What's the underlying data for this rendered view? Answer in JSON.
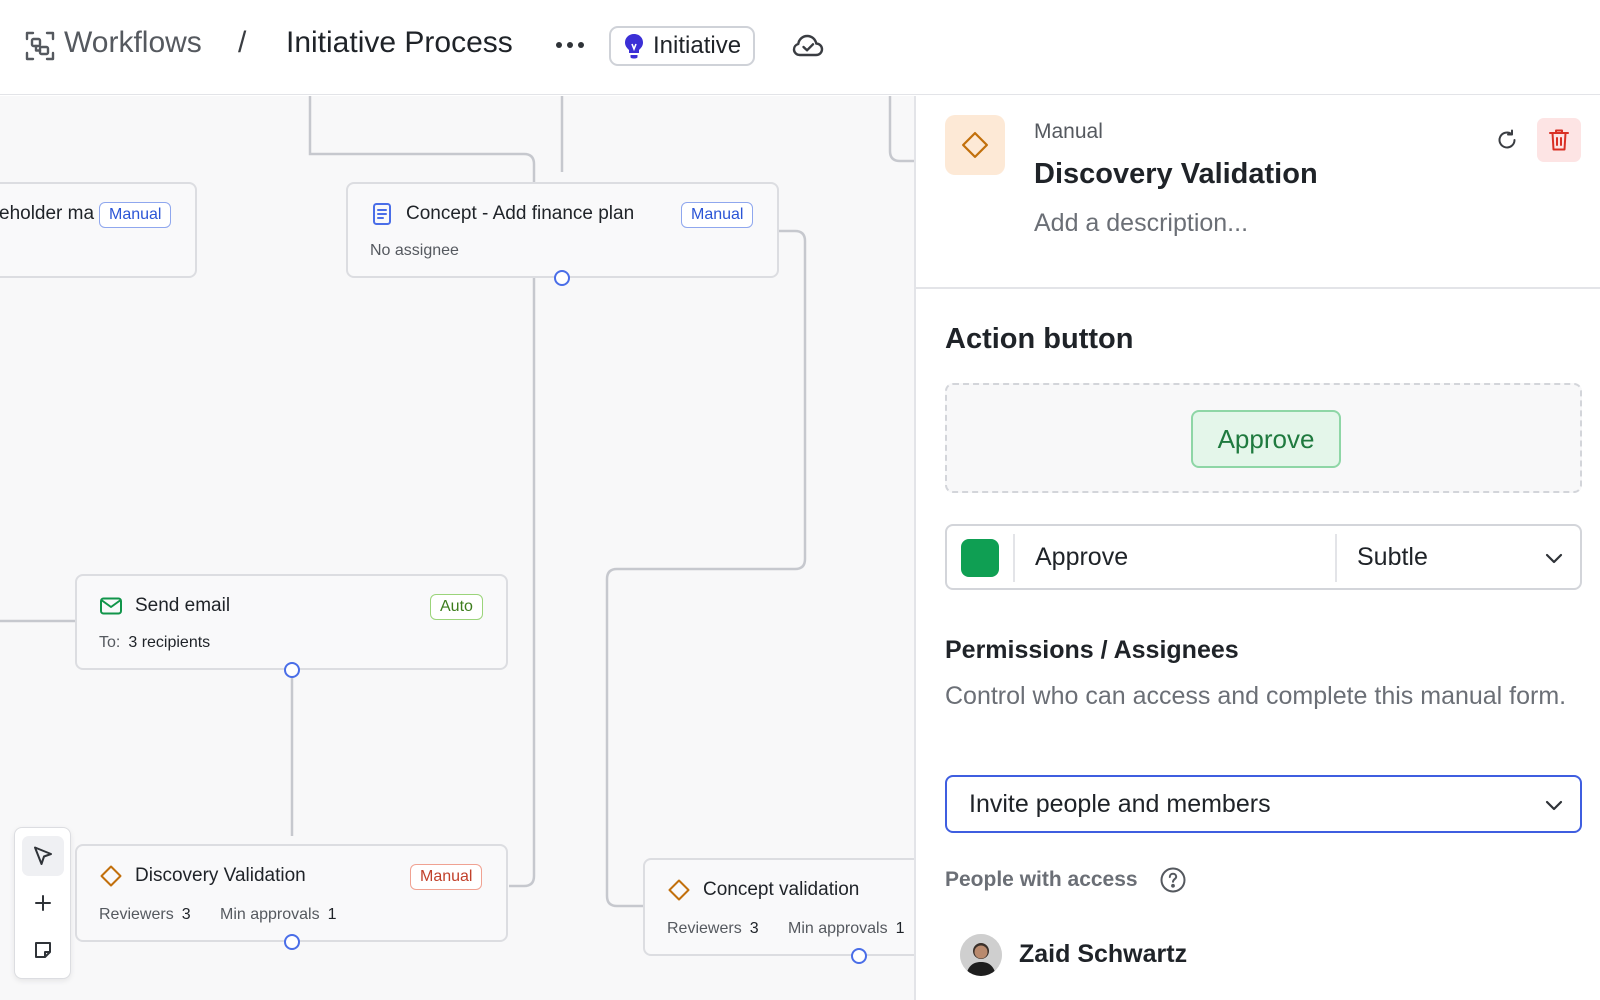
{
  "header": {
    "breadcrumb_root": "Workflows",
    "separator": "/",
    "title": "Initiative Process",
    "type_pill": "Initiative",
    "icons": [
      "workflow-icon",
      "more-icon",
      "lightbulb-icon",
      "cloud-check-icon"
    ]
  },
  "canvas": {
    "nodes": {
      "stakeholder": {
        "title": "eholder ma",
        "tag": "Manual"
      },
      "finance": {
        "title": "Concept - Add finance plan",
        "tag": "Manual",
        "sub": "No assignee"
      },
      "email": {
        "title": "Send email",
        "tag": "Auto",
        "sub_label": "To:",
        "sub_value": "3 recipients"
      },
      "discovery": {
        "title": "Discovery Validation",
        "tag": "Manual",
        "reviewers_label": "Reviewers",
        "reviewers_value": "3",
        "min_label": "Min approvals",
        "min_value": "1"
      },
      "concept": {
        "title": "Concept validation",
        "reviewers_label": "Reviewers",
        "reviewers_value": "3",
        "min_label": "Min approvals",
        "min_value": "1"
      }
    },
    "tools": [
      "pointer-icon",
      "plus-icon",
      "note-icon"
    ]
  },
  "panel": {
    "kind": "Manual",
    "title": "Discovery Validation",
    "description_placeholder": "Add a description...",
    "action_section_title": "Action button",
    "preview_button_label": "Approve",
    "button_label": "Approve",
    "button_style": "Subtle",
    "button_color": "#0f9f53",
    "permissions_title": "Permissions / Assignees",
    "permissions_desc": "Control who can access and complete this manual form.",
    "invite_select": "Invite people and members",
    "people_label": "People with access",
    "people": [
      {
        "name": "Zaid Schwartz"
      }
    ]
  },
  "colors": {
    "accent": "#3f5ee0",
    "port": "#4a6ee8",
    "success": "#0f9f53",
    "danger": "#d93025",
    "manual_orange": "#c2700c"
  }
}
